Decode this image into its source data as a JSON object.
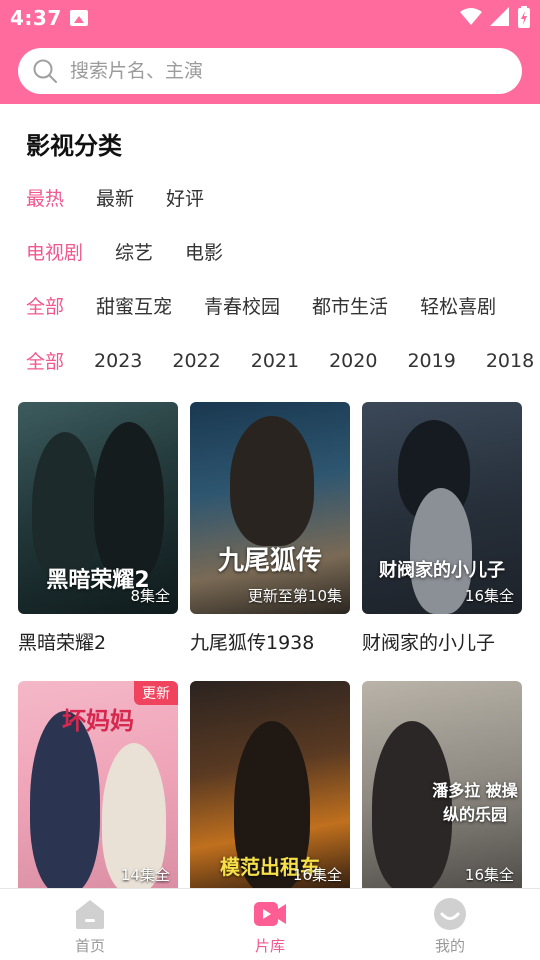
{
  "status_bar": {
    "time": "4:37"
  },
  "search": {
    "placeholder": "搜索片名、主演"
  },
  "category": {
    "title": "影视分类",
    "sort": {
      "items": [
        "最热",
        "最新",
        "好评"
      ],
      "active": "最热"
    },
    "type": {
      "items": [
        "电视剧",
        "综艺",
        "电影"
      ],
      "active": "电视剧"
    },
    "genre": {
      "items": [
        "全部",
        "甜蜜互宠",
        "青春校园",
        "都市生活",
        "轻松喜剧"
      ],
      "active": "全部"
    },
    "year": {
      "items": [
        "全部",
        "2023",
        "2022",
        "2021",
        "2020",
        "2019",
        "2018"
      ],
      "active": "全部"
    }
  },
  "videos": [
    {
      "title": "黑暗荣耀2",
      "badge": "8集全",
      "poster_text": "黑暗荣耀2"
    },
    {
      "title": "九尾狐传1938",
      "badge": "更新至第10集",
      "poster_text": "九尾狐传"
    },
    {
      "title": "财阀家的小儿子",
      "badge": "16集全",
      "poster_text": "财阀家的小儿子"
    },
    {
      "title": "",
      "badge": "14集全",
      "tag": "更新",
      "poster_text": "坏妈妈"
    },
    {
      "title": "",
      "badge": "16集全",
      "poster_text": "模范出租车"
    },
    {
      "title": "",
      "badge": "16集全",
      "poster_text": "潘多拉 被操纵的乐园"
    }
  ],
  "bottom_nav": {
    "items": [
      {
        "label": "首页",
        "icon": "home-icon"
      },
      {
        "label": "片库",
        "icon": "video-library-icon",
        "active": true
      },
      {
        "label": "我的",
        "icon": "profile-icon"
      }
    ]
  },
  "colors": {
    "header": "#FF6B9C",
    "accent": "#F0588E",
    "tag": "#F0445E"
  }
}
